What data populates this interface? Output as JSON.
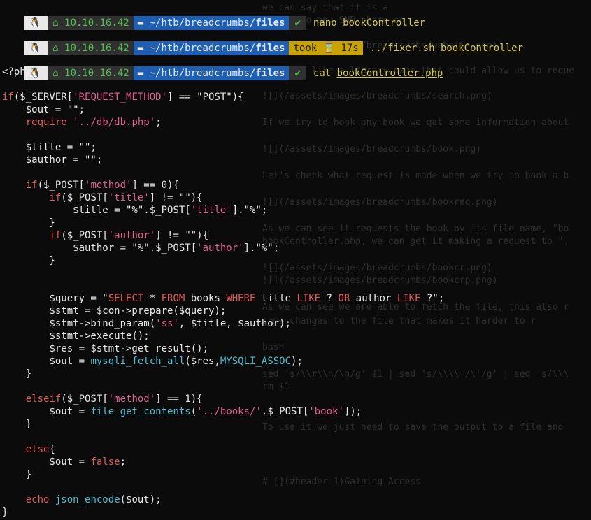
{
  "prompts": [
    {
      "host": "10.10.16.42",
      "dir_prefix": "~/htb/breadcrumbs/",
      "dir_bold": "files",
      "ok": "✔",
      "took": "",
      "took_val": "",
      "cmd": "nano",
      "arg": "bookController"
    },
    {
      "host": "10.10.16.42",
      "dir_prefix": "~/htb/breadcrumbs/",
      "dir_bold": "files",
      "ok": "",
      "took": "took",
      "took_val": "17s",
      "cmd": "../fixer.sh",
      "arg": "bookController"
    },
    {
      "host": "10.10.16.42",
      "dir_prefix": "~/htb/breadcrumbs/",
      "dir_bold": "files",
      "ok": "✔",
      "took": "",
      "took_val": "",
      "cmd": "cat",
      "arg": "bookController.php"
    }
  ],
  "code_lines": [
    "<?php",
    "",
    "if($_SERVER['REQUEST_METHOD'] == \"POST\"){",
    "    $out = \"\";",
    "    require '../db/db.php';",
    "",
    "    $title = \"\";",
    "    $author = \"\";",
    "",
    "    if($_POST['method'] == 0){",
    "        if($_POST['title'] != \"\"){",
    "            $title = \"%\".$_POST['title'].\"%\";",
    "        }",
    "        if($_POST['author'] != \"\"){",
    "            $author = \"%\".$_POST['author'].\"%\";",
    "        }",
    "",
    "",
    "        $query = \"SELECT * FROM books WHERE title LIKE ? OR author LIKE ?\";",
    "        $stmt = $con->prepare($query);",
    "        $stmt->bind_param('ss', $title, $author);",
    "        $stmt->execute();",
    "        $res = $stmt->get_result();",
    "        $out = mysqli_fetch_all($res,MYSQLI_ASSOC);",
    "    }",
    "",
    "    elseif($_POST['method'] == 1){",
    "        $out = file_get_contents('../books/'.$_POST['book']);",
    "    }",
    "",
    "    else{",
    "        $out = false;",
    "    }",
    "",
    "    echo json_encode($out);",
    "}"
  ],
  "ghost_lines": [
    "we can say that it is a",
    "access to any SMB share so",
    "![](/assets/images/breadcrumbs/website.png)",
    "It seems like a library page that could allow us to reque",
    "![](/assets/images/breadcrumbs/search.png)",
    "If we try to book any book we get some information about",
    "![](/assets/images/breadcrumbs/book.png)",
    "Let's check what request is made when we try to book a b",
    "![](/assets/images/breadcrumbs/bookreq.png)",
    "As we can see it requests the book by its file name, \"bo",
    "bookController.php, we can get it making a request to \".",
    "![](/assets/images/breadcrumbs/bookcr.png)",
    "![](/assets/images/breadcrumbs/bookcrp.png)",
    "As we can see we are able to fetch the file, this also r",
    "some changes to the file that makes it harder to r",
    "bash",
    "sed 's/\\\\r\\\\n/\\n/g' $1 | sed 's/\\\\\\\\'/\\'/g' | sed 's/\\\\\\",
    "rm $1",
    "To use it we just need to save the output to a file and",
    "# [](#header-1)Gaining Access"
  ]
}
